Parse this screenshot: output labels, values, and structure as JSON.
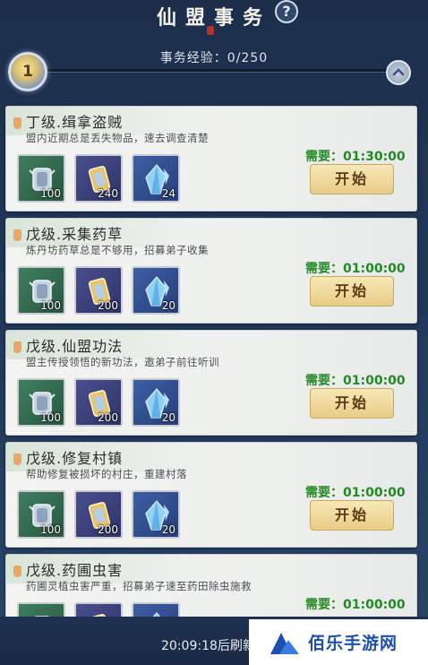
{
  "header": {
    "title": "仙盟事务",
    "help_label": "?"
  },
  "progress": {
    "xp_text": "事务经验：0/250",
    "level": "1"
  },
  "tasks": [
    {
      "name": "丁级.缉拿盗贼",
      "desc": "盟内近期总是丢失物品，速去调查清楚",
      "rewards": [
        {
          "icon": "silver-ingot-icon",
          "count": "100"
        },
        {
          "icon": "gold-token-icon",
          "count": "240"
        },
        {
          "icon": "blue-crystal-icon",
          "count": "24"
        }
      ],
      "req_label": "需要：",
      "time": "01:30:00",
      "button": "开始"
    },
    {
      "name": "戊级.采集药草",
      "desc": "炼丹坊药草总是不够用，招募弟子收集",
      "rewards": [
        {
          "icon": "silver-ingot-icon",
          "count": "100"
        },
        {
          "icon": "gold-token-icon",
          "count": "200"
        },
        {
          "icon": "blue-crystal-icon",
          "count": "20"
        }
      ],
      "req_label": "需要：",
      "time": "01:00:00",
      "button": "开始"
    },
    {
      "name": "戊级.仙盟功法",
      "desc": "盟主传授领悟的新功法，邀弟子前往听训",
      "rewards": [
        {
          "icon": "silver-ingot-icon",
          "count": "100"
        },
        {
          "icon": "gold-token-icon",
          "count": "200"
        },
        {
          "icon": "blue-crystal-icon",
          "count": "20"
        }
      ],
      "req_label": "需要：",
      "time": "01:00:00",
      "button": "开始"
    },
    {
      "name": "戊级.修复村镇",
      "desc": "帮助修复被损坏的村庄，重建村落",
      "rewards": [
        {
          "icon": "silver-ingot-icon",
          "count": "100"
        },
        {
          "icon": "gold-token-icon",
          "count": "200"
        },
        {
          "icon": "blue-crystal-icon",
          "count": "20"
        }
      ],
      "req_label": "需要：",
      "time": "01:00:00",
      "button": "开始"
    },
    {
      "name": "戊级.药圃虫害",
      "desc": "药圃灵植虫害严重，招募弟子速至药田除虫施救",
      "rewards": [
        {
          "icon": "silver-ingot-icon",
          "count": ""
        },
        {
          "icon": "gold-token-icon",
          "count": ""
        },
        {
          "icon": "blue-crystal-icon",
          "count": ""
        }
      ],
      "req_label": "需要：",
      "time": "01:00:00",
      "button": ""
    }
  ],
  "footer": {
    "refresh_text": "20:09:18后刷新"
  },
  "watermark": {
    "text": "佰乐手游网"
  },
  "colors": {
    "background": "#22385a",
    "card": "#f0f2ef",
    "requirement_green": "#2a8a2a",
    "button_gold": "#ecd494"
  }
}
